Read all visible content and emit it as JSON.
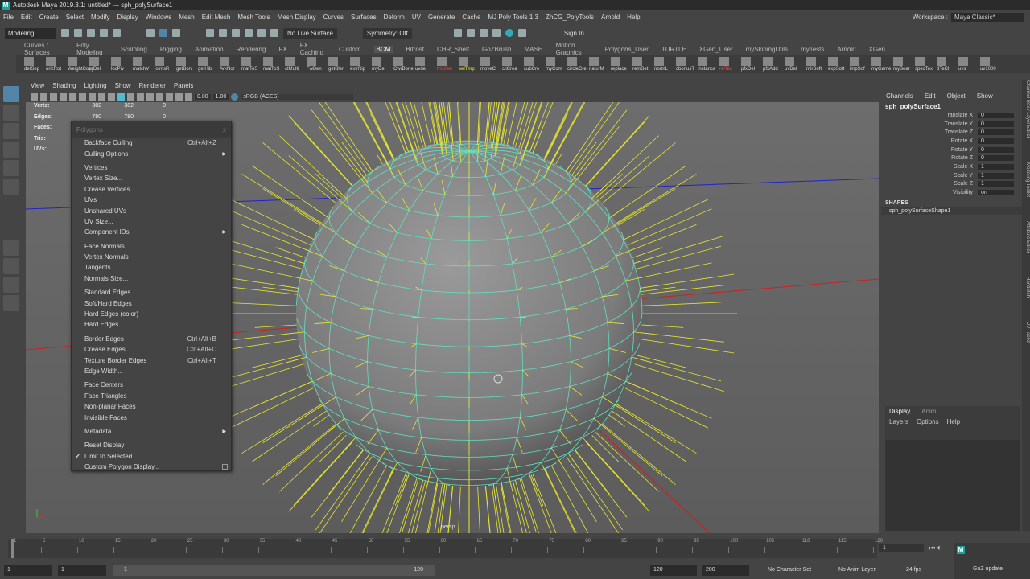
{
  "title": "Autodesk Maya 2019.3.1: untitled*   ---   sph_polySurface1",
  "menus": [
    "File",
    "Edit",
    "Create",
    "Select",
    "Modify",
    "Display",
    "Windows",
    "Mesh",
    "Edit Mesh",
    "Mesh Tools",
    "Mesh Display",
    "Curves",
    "Surfaces",
    "Deform",
    "UV",
    "Generate",
    "Cache",
    "MJ Poly Tools 1.3",
    "ZhCG_PolyTools",
    "Arnold",
    "Help"
  ],
  "workspace": {
    "label": "Workspace :",
    "value": "Maya Classic*"
  },
  "status": {
    "mode": "Modeling",
    "live_surface": "No Live Surface",
    "symmetry": "Symmetry: Off",
    "sign_in": "Sign In"
  },
  "shelf_tabs": [
    "Curves / Surfaces",
    "Poly Modeling",
    "Sculpting",
    "Rigging",
    "Animation",
    "Rendering",
    "FX",
    "FX Caching",
    "Custom",
    "BCM",
    "Bifrost",
    "CHR_Shelf",
    "GoZBrush",
    "MASH",
    "Motion Graphics",
    "Polygons_User",
    "TURTLE",
    "XGen_User",
    "mySkiningUtils",
    "myTests",
    "Arnold",
    "XGen"
  ],
  "shelf_labels": [
    "detSep",
    "orizRot",
    "WeightCopy",
    "rsDel",
    "locPiv",
    "matchV",
    "jointsR",
    "getBon",
    "getHib",
    "ArkNor",
    "matToS",
    "matToS",
    "ctMulti",
    "FwBen",
    "getBlen",
    "extrRip",
    "myDel",
    "CwrBone",
    "uvdel",
    "tmpSel",
    "selTmp",
    "moveC",
    "cliCrea",
    "cubCre",
    "myCom",
    "circleCre",
    "naturM",
    "replace",
    "remSet",
    "normL",
    "cbonusT",
    "instance",
    "relTex",
    "pfxDel",
    "pfxAdd",
    "uvDel",
    "mirSoft",
    "expSoft",
    "impSof",
    "myGame",
    "myBear",
    "specTex",
    "dTeCl",
    "uvs",
    "uv1000"
  ],
  "panel_menu": [
    "View",
    "Shading",
    "Lighting",
    "Show",
    "Renderer",
    "Panels"
  ],
  "panel_toolbar": {
    "exposure": "0.00",
    "gamma": "1.00",
    "color_space": "sRGB (ACES)"
  },
  "hud": [
    {
      "label": "Verts:",
      "a": "382",
      "b": "382",
      "c": "0"
    },
    {
      "label": "Edges:",
      "a": "780",
      "b": "780",
      "c": "0"
    },
    {
      "label": "Faces:",
      "a": "",
      "b": "",
      "c": ""
    },
    {
      "label": "Tris:",
      "a": "",
      "b": "",
      "c": ""
    },
    {
      "label": "UVs:",
      "a": "",
      "b": "",
      "c": ""
    }
  ],
  "camera_label": "persp",
  "popup": {
    "title": "Polygons",
    "close": "x",
    "items": [
      {
        "label": "Backface Culling",
        "shortcut": "Ctrl+Alt+Z"
      },
      {
        "label": "Culling Options",
        "submenu": true
      },
      {
        "sep": true
      },
      {
        "label": "Vertices"
      },
      {
        "label": "Vertex Size..."
      },
      {
        "label": "Crease Vertices"
      },
      {
        "label": "UVs"
      },
      {
        "label": "Unshared UVs"
      },
      {
        "label": "UV Size..."
      },
      {
        "label": "Component IDs",
        "submenu": true
      },
      {
        "sep": true
      },
      {
        "label": "Face Normals"
      },
      {
        "label": "Vertex Normals"
      },
      {
        "label": "Tangents"
      },
      {
        "label": "Normals Size..."
      },
      {
        "sep": true
      },
      {
        "label": "Standard Edges"
      },
      {
        "label": "Soft/Hard Edges"
      },
      {
        "label": "Hard Edges (color)"
      },
      {
        "label": "Hard Edges"
      },
      {
        "sep": true
      },
      {
        "label": "Border Edges",
        "shortcut": "Ctrl+Alt+B"
      },
      {
        "label": "Crease Edges",
        "shortcut": "Ctrl+Alt+C"
      },
      {
        "label": "Texture Border Edges",
        "shortcut": "Ctrl+Alt+T"
      },
      {
        "label": "Edge Width..."
      },
      {
        "sep": true
      },
      {
        "label": "Face Centers"
      },
      {
        "label": "Face Triangles"
      },
      {
        "label": "Non-planar Faces"
      },
      {
        "label": "Invisible Faces"
      },
      {
        "sep": true
      },
      {
        "label": "Metadata",
        "submenu": true
      },
      {
        "sep": true
      },
      {
        "label": "Reset Display"
      },
      {
        "label": "Limit to Selected",
        "checked": true
      },
      {
        "label": "Custom Polygon Display...",
        "option_box": true
      }
    ]
  },
  "channel_box": {
    "menus": [
      "Channels",
      "Edit",
      "Object",
      "Show"
    ],
    "object": "sph_polySurface1",
    "channels": [
      {
        "name": "Translate X",
        "value": "0"
      },
      {
        "name": "Translate Y",
        "value": "0"
      },
      {
        "name": "Translate Z",
        "value": "0"
      },
      {
        "name": "Rotate X",
        "value": "0"
      },
      {
        "name": "Rotate Y",
        "value": "0"
      },
      {
        "name": "Rotate Z",
        "value": "0"
      },
      {
        "name": "Scale X",
        "value": "1"
      },
      {
        "name": "Scale Y",
        "value": "1"
      },
      {
        "name": "Scale Z",
        "value": "1"
      },
      {
        "name": "Visibility",
        "value": "on"
      }
    ],
    "shapes_header": "SHAPES",
    "shape": "sph_polySurfaceShape1"
  },
  "side_tabs": [
    "Channel Box / Layer Editor",
    "Modeling Toolkit",
    "Attribute Editor",
    "HandMeh",
    "UV Toolkit"
  ],
  "layer_editor": {
    "tabs": [
      "Display",
      "Anim"
    ],
    "menus": [
      "Layers",
      "Options",
      "Help"
    ]
  },
  "timeline": {
    "ticks": [
      "1",
      "5",
      "10",
      "15",
      "20",
      "25",
      "30",
      "35",
      "40",
      "45",
      "50",
      "55",
      "60",
      "65",
      "70",
      "75",
      "80",
      "85",
      "90",
      "95",
      "100",
      "105",
      "110",
      "115",
      "120"
    ],
    "current_frame": "1"
  },
  "range": {
    "start": "1",
    "anim_start": "1",
    "slider_start": "1",
    "slider_end": "120",
    "end": "120",
    "anim_end": "200",
    "char_set": "No Character Set",
    "anim_layer": "No Anim Layer",
    "fps": "24 fps",
    "goz": "GoZ update"
  },
  "colors": {
    "accent": "#5285a6",
    "wire": "#5fe0c0",
    "normals": "#e8e830"
  }
}
